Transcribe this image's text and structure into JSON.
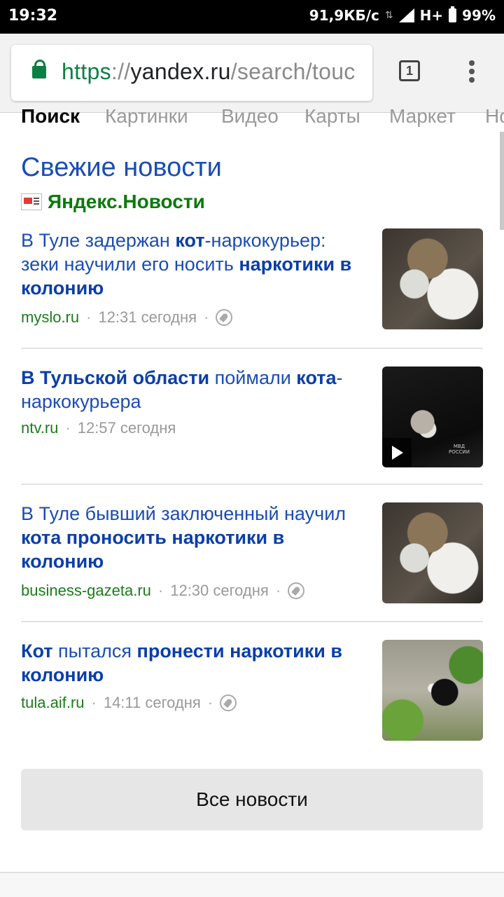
{
  "status_bar": {
    "time": "19:32",
    "network_speed": "91,9КБ/с",
    "network_type": "H+",
    "battery": "99%"
  },
  "browser": {
    "url_scheme": "https",
    "url_sep": "://",
    "url_host": "yandex.ru",
    "url_path": "/search/touc",
    "tab_count": "1"
  },
  "nav": {
    "items": [
      "Поиск",
      "Картинки",
      "Видео",
      "Карты",
      "Маркет",
      "Но"
    ]
  },
  "news": {
    "title": "Свежие новости",
    "source": "Яндекс.Новости",
    "items": [
      {
        "title_parts": [
          {
            "text": "В Туле задержан ",
            "bold": false
          },
          {
            "text": "кот",
            "bold": true
          },
          {
            "text": "-наркокурьер: зеки научили его носить ",
            "bold": false
          },
          {
            "text": "наркотики в колонию",
            "bold": true
          }
        ],
        "site": "myslo.ru",
        "time": "12:31 сегодня",
        "has_rocket": true,
        "thumb_icon": "cat-photo"
      },
      {
        "title_parts": [
          {
            "text": "В Тульской области",
            "bold": true
          },
          {
            "text": " поймали ",
            "bold": false
          },
          {
            "text": "кота",
            "bold": true
          },
          {
            "text": "-наркокурьера",
            "bold": false
          }
        ],
        "site": "ntv.ru",
        "time": "12:57 сегодня",
        "has_rocket": false,
        "thumb_icon": "cat-video",
        "thumb_caption": "МВД РОССИИ"
      },
      {
        "title_parts": [
          {
            "text": "В Туле бывший заключенный научил ",
            "bold": false
          },
          {
            "text": "кота проносить наркотики в колонию",
            "bold": true
          }
        ],
        "site": "business-gazeta.ru",
        "time": "12:30 сегодня",
        "has_rocket": true,
        "thumb_icon": "cat-photo"
      },
      {
        "title_parts": [
          {
            "text": "Кот",
            "bold": true
          },
          {
            "text": " пытался ",
            "bold": false
          },
          {
            "text": "пронести наркотики в колонию",
            "bold": true
          }
        ],
        "site": "tula.aif.ru",
        "time": "14:11 сегодня",
        "has_rocket": true,
        "thumb_icon": "cat-photo"
      }
    ],
    "all_news_label": "Все новости"
  }
}
